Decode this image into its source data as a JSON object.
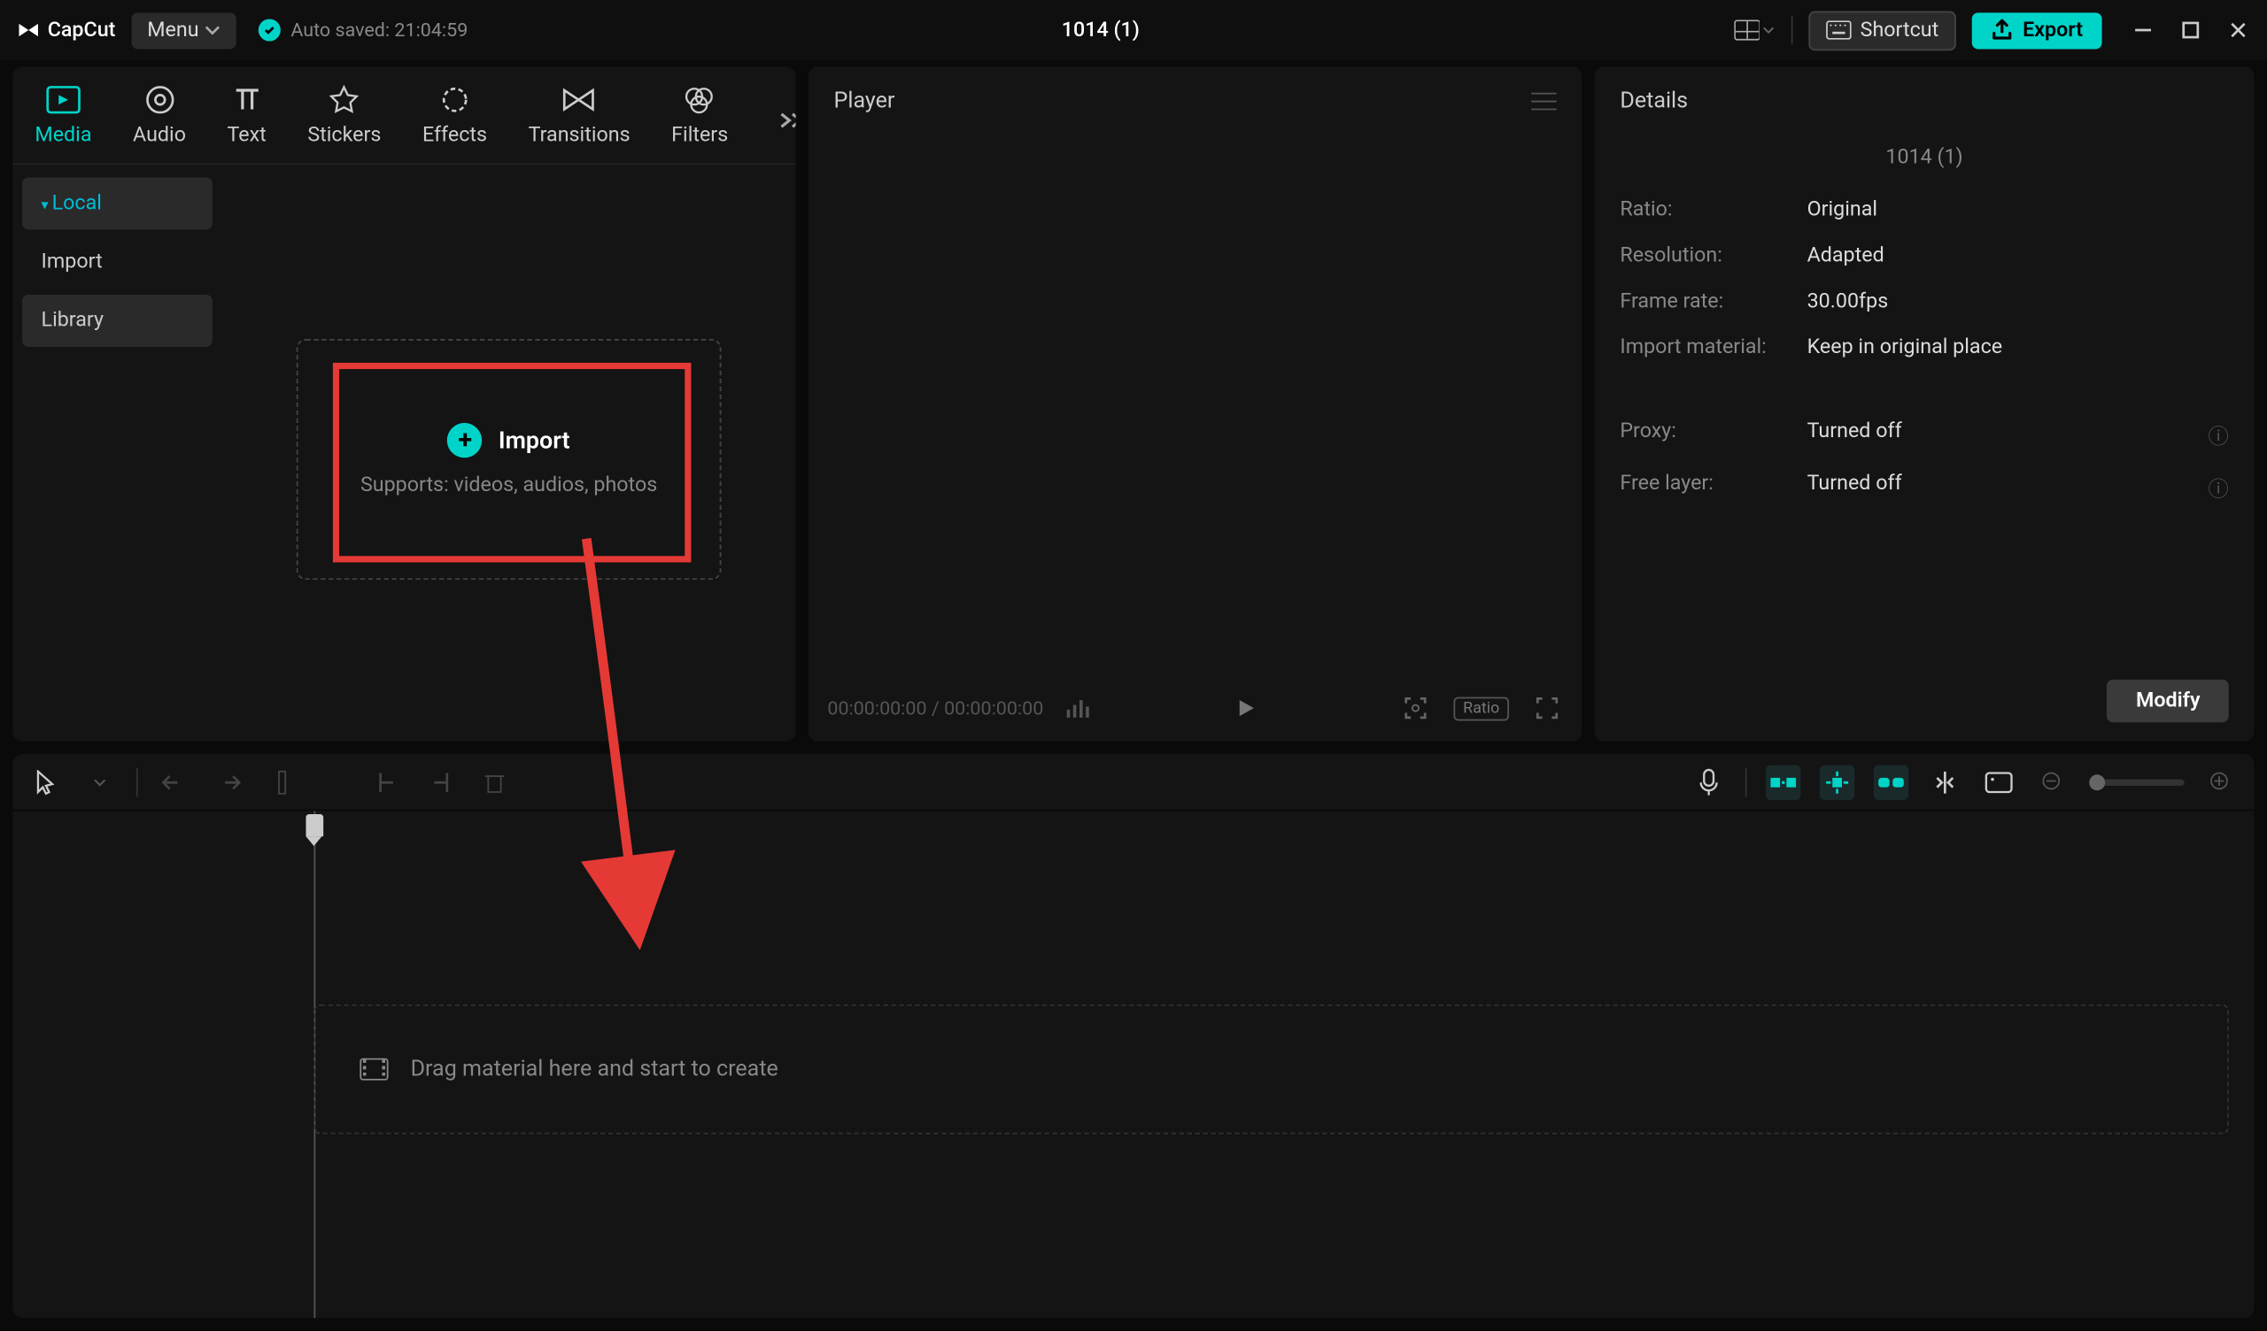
{
  "app_name": "CapCut",
  "menu_label": "Menu",
  "autosave_text": "Auto saved: 21:04:59",
  "project_title": "1014 (1)",
  "shortcut_label": "Shortcut",
  "export_label": "Export",
  "media_tabs": {
    "media": "Media",
    "audio": "Audio",
    "text": "Text",
    "stickers": "Stickers",
    "effects": "Effects",
    "transitions": "Transitions",
    "filters": "Filters"
  },
  "sidebar": {
    "local": "Local",
    "import": "Import",
    "library": "Library"
  },
  "import_box": {
    "label": "Import",
    "subtext": "Supports: videos, audios, photos"
  },
  "player": {
    "title": "Player",
    "time_current": "00:00:00:00",
    "time_total": "00:00:00:00",
    "ratio": "Ratio"
  },
  "details": {
    "title": "Details",
    "project_name_cut": "1014 (1)",
    "rows": {
      "ratio": {
        "label": "Ratio:",
        "value": "Original"
      },
      "resolution": {
        "label": "Resolution:",
        "value": "Adapted"
      },
      "framerate": {
        "label": "Frame rate:",
        "value": "30.00fps"
      },
      "import_material": {
        "label": "Import material:",
        "value": "Keep in original place"
      },
      "proxy": {
        "label": "Proxy:",
        "value": "Turned off"
      },
      "free_layer": {
        "label": "Free layer:",
        "value": "Turned off"
      }
    },
    "modify": "Modify"
  },
  "timeline": {
    "drop_hint": "Drag material here and start to create"
  }
}
